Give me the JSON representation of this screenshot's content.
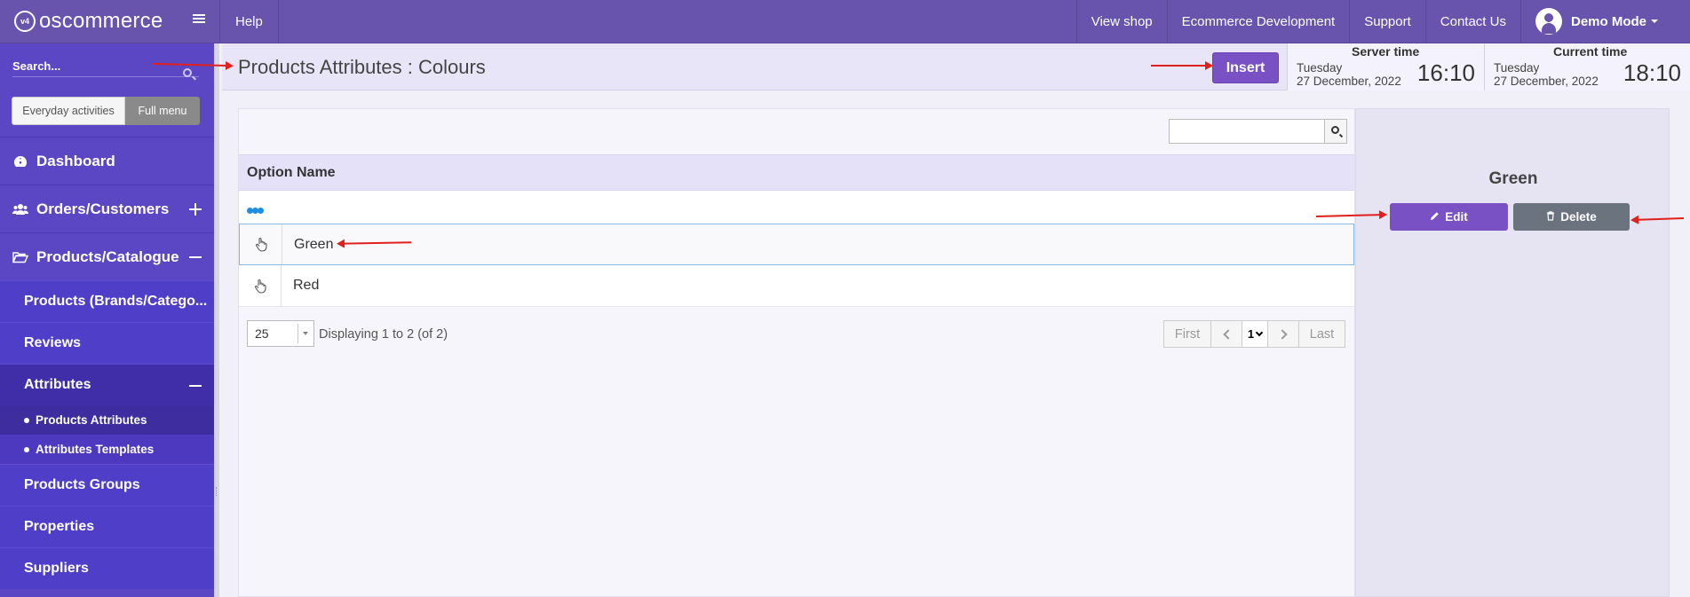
{
  "app": {
    "logo_badge": "v4",
    "logo_text": "oscommerce"
  },
  "topbar": {
    "help": "Help",
    "links": [
      "View shop",
      "Ecommerce Development",
      "Support",
      "Contact Us"
    ],
    "user": "Demo Mode"
  },
  "sidebar": {
    "search_placeholder": "Search...",
    "toggle": {
      "everyday": "Everyday activities",
      "full": "Full menu"
    },
    "items": {
      "dashboard": "Dashboard",
      "orders": "Orders/Customers",
      "products": "Products/Catalogue"
    },
    "sub": {
      "products_brands": "Products (Brands/Catego...",
      "reviews": "Reviews",
      "attributes": "Attributes",
      "products_attributes": "Products Attributes",
      "attributes_templates": "Attributes Templates",
      "products_groups": "Products Groups",
      "properties": "Properties",
      "suppliers": "Suppliers"
    }
  },
  "header": {
    "title": "Products Attributes : Colours",
    "insert_label": "Insert",
    "server_time": {
      "label": "Server time",
      "day": "Tuesday",
      "date": "27 December, 2022",
      "clock": "16:10"
    },
    "current_time": {
      "label": "Current time",
      "day": "Tuesday",
      "date": "27 December, 2022",
      "clock": "18:10"
    }
  },
  "table": {
    "search_value": "",
    "column_header": "Option Name",
    "rows": [
      {
        "name": "Green",
        "selected": true
      },
      {
        "name": "Red",
        "selected": false
      }
    ],
    "per_page": "25",
    "displaying": "Displaying 1 to 2 (of 2)",
    "pager": {
      "first": "First",
      "page": "1",
      "last": "Last"
    }
  },
  "detail": {
    "title": "Green",
    "edit_label": "Edit",
    "delete_label": "Delete"
  },
  "colors": {
    "topbar": "#6853ad",
    "sidebar": "#5b46c4",
    "accent": "#7a51c5",
    "delete": "#6b747e",
    "annotation": "#e0201b"
  }
}
